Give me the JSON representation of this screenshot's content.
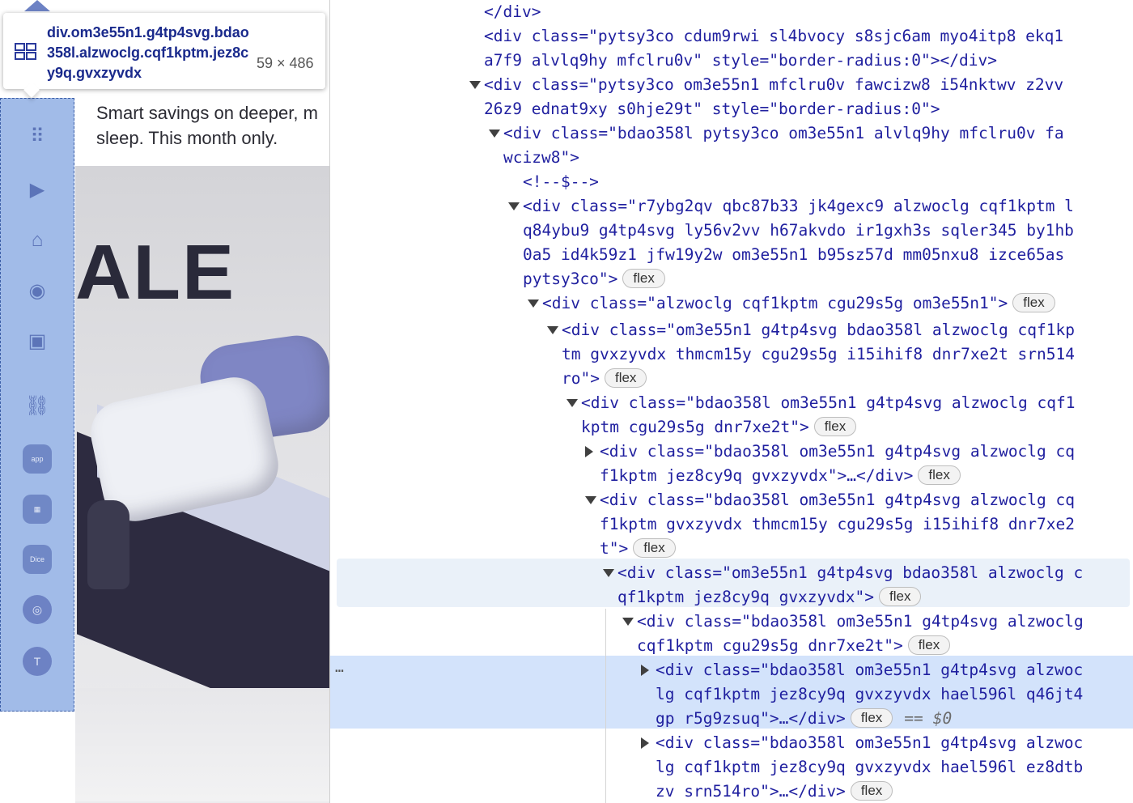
{
  "page": {
    "promo_text": "Smart savings on deeper, m\nsleep. This month only.",
    "sale_text": "ALE"
  },
  "tooltip": {
    "selector": "div.om3e55n1.g4tp4svg.bdao358l.alzwoclg.cqf1kptm.jez8cy9q.gvxzyvdx",
    "size": "59 × 486"
  },
  "sidebar": {
    "icons": [
      {
        "name": "grid-icon",
        "glyph": "⠿"
      },
      {
        "name": "video-icon",
        "glyph": "▶"
      },
      {
        "name": "marketplace-icon",
        "glyph": "⌂"
      },
      {
        "name": "groups-icon",
        "glyph": "◉"
      },
      {
        "name": "gaming-icon",
        "glyph": "▣"
      },
      {
        "name": "link-icon",
        "glyph": "⛓"
      },
      {
        "name": "app-icon-1",
        "glyph": "app"
      },
      {
        "name": "app-icon-2",
        "glyph": "▦"
      },
      {
        "name": "app-icon-dice",
        "glyph": "Dice"
      },
      {
        "name": "app-icon-4",
        "glyph": "◎"
      },
      {
        "name": "app-icon-t",
        "glyph": "T"
      }
    ]
  },
  "devtools": {
    "lines": [
      {
        "text": "</div>"
      },
      {
        "text": "<div class=\"pytsy3co cdum9rwi sl4bvocy s8sjc6am myo4itp8 ekq1"
      },
      {
        "text": "a7f9 alvlq9hy mfclru0v\" style=\"border-radius:0\"></div>"
      },
      {
        "text": "<div class=\"pytsy3co om3e55n1 mfclru0v fawcizw8 i54nktwv z2vv"
      },
      {
        "text": "26z9 ednat9xy s0hje29t\" style=\"border-radius:0\">"
      },
      {
        "text": "<div class=\"bdao358l pytsy3co om3e55n1 alvlq9hy mfclru0v fa"
      },
      {
        "text": "wcizw8\">"
      },
      {
        "text": "<!--$-->"
      },
      {
        "text": "<div class=\"r7ybg2qv qbc87b33 jk4gexc9 alzwoclg cqf1kptm l"
      },
      {
        "text": "q84ybu9 g4tp4svg ly56v2vv h67akvdo ir1gxh3s sqler345 by1hb"
      },
      {
        "text": "0a5 id4k59z1 jfw19y2w om3e55n1 b95sz57d mm05nxu8 izce65as"
      },
      {
        "text": "pytsy3co\">"
      },
      {
        "text": "<div class=\"alzwoclg cqf1kptm cgu29s5g om3e55n1\">"
      },
      {
        "text": "<div class=\"om3e55n1 g4tp4svg bdao358l alzwoclg cqf1kp"
      },
      {
        "text": "tm gvxzyvdx thmcm15y cgu29s5g i15ihif8 dnr7xe2t srn514"
      },
      {
        "text": "ro\">"
      },
      {
        "text": "<div class=\"bdao358l om3e55n1 g4tp4svg alzwoclg cqf1"
      },
      {
        "text": "kptm cgu29s5g dnr7xe2t\">"
      },
      {
        "text": "<div class=\"bdao358l om3e55n1 g4tp4svg alzwoclg cq"
      },
      {
        "text": "f1kptm jez8cy9q gvxzyvdx\">…</div>"
      },
      {
        "text": "<div class=\"bdao358l om3e55n1 g4tp4svg alzwoclg cq"
      },
      {
        "text": "f1kptm gvxzyvdx thmcm15y cgu29s5g i15ihif8 dnr7xe2"
      },
      {
        "text": "t\">"
      },
      {
        "text": "<div class=\"om3e55n1 g4tp4svg bdao358l alzwoclg c"
      },
      {
        "text": "qf1kptm jez8cy9q gvxzyvdx\">"
      },
      {
        "text": "<div class=\"bdao358l om3e55n1 g4tp4svg alzwoclg"
      },
      {
        "text": "cqf1kptm cgu29s5g dnr7xe2t\">"
      },
      {
        "text": "<div class=\"bdao358l om3e55n1 g4tp4svg alzwoc"
      },
      {
        "text": "lg cqf1kptm jez8cy9q gvxzyvdx hael596l q46jt4"
      },
      {
        "text": "gp r5g9zsuq\">…</div>"
      },
      {
        "text": "<div class=\"bdao358l om3e55n1 g4tp4svg alzwoc"
      },
      {
        "text": "lg cqf1kptm jez8cy9q gvxzyvdx hael596l ez8dtb"
      },
      {
        "text": "zv srn514ro\">…</div>"
      }
    ],
    "badge_label": "flex",
    "eq_label": "==",
    "dollar_label": "$0",
    "ellipsis": "…"
  }
}
